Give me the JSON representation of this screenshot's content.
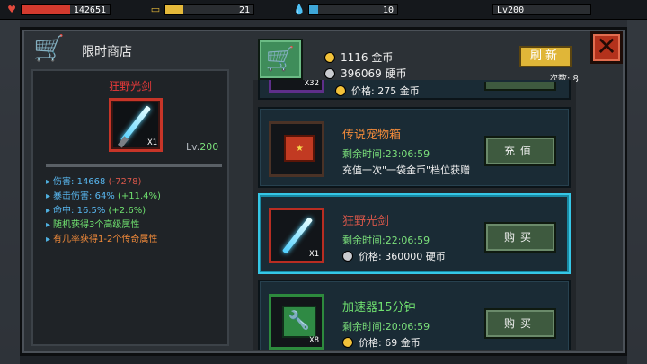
{
  "hud": {
    "hp": "142651",
    "hp_fill": 0.55,
    "energy": "21",
    "energy_fill": 0.2,
    "water": "10",
    "water_fill": 0.1,
    "level": "Lv200",
    "level_fill": 0.0
  },
  "shop": {
    "title": "限时商店",
    "gold": "1116 金币",
    "silver": "396069 硬币",
    "refresh_label": "刷新",
    "refresh_count": "次数: 8"
  },
  "detail": {
    "name": "狂野光剑",
    "qty": "X1",
    "level_prefix": "Lv.",
    "level_value": "200",
    "stats": [
      {
        "label": "伤害: 14668 ",
        "delta": "(-7278)"
      },
      {
        "label": "暴击伤害: 64% ",
        "delta": "(+11.4%)"
      },
      {
        "label": "命中: 16.5% ",
        "delta": "(+2.6%)"
      }
    ],
    "perk1": "随机获得3个高级属性",
    "perk2": "有几率获得1-2个传奇属性"
  },
  "list": {
    "partial": {
      "qty": "X32",
      "price": "价格: 275 金币"
    },
    "items": [
      {
        "title": "传说宠物箱",
        "time": "剩余时间:23:06:59",
        "line2": "充值一次\"一袋金币\"档位获赠",
        "button": "充值"
      },
      {
        "title": "狂野光剑",
        "qty": "X1",
        "time": "剩余时间:22:06:59",
        "line2": "价格: 360000 硬币",
        "button": "购买"
      },
      {
        "title": "加速器15分钟",
        "qty": "X8",
        "time": "剩余时间:20:06:59",
        "line2": "价格: 69 金币",
        "button": "购买"
      }
    ]
  },
  "colors": {
    "accent_green": "#3f8d5a",
    "close_red": "#b3321c",
    "refresh_gold": "#e0b638",
    "selected_cyan": "#36c7e6"
  }
}
